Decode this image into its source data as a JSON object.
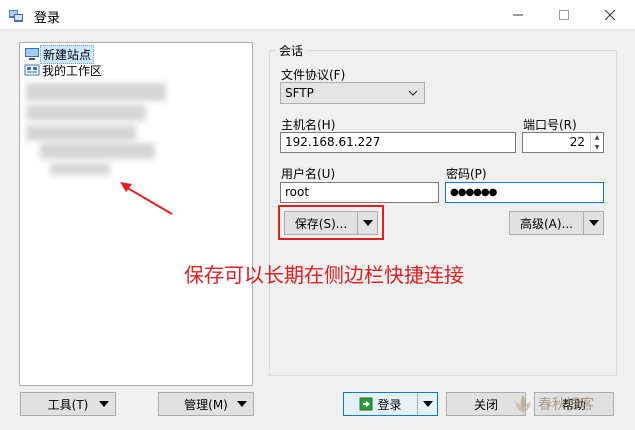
{
  "window": {
    "title": "登录"
  },
  "tree": {
    "items": [
      {
        "label": "新建站点"
      },
      {
        "label": "我的工作区"
      }
    ]
  },
  "left_buttons": {
    "tools": "工具(T)",
    "manage": "管理(M)"
  },
  "session": {
    "legend": "会话",
    "protocol_label": "文件协议(F)",
    "protocol_value": "SFTP",
    "host_label": "主机名(H)",
    "host_value": "192.168.61.227",
    "port_label": "端口号(R)",
    "port_value": "22",
    "user_label": "用户名(U)",
    "user_value": "root",
    "password_label": "密码(P)",
    "password_value": "●●●●●●",
    "save_button": "保存(S)...",
    "advanced_button": "高级(A)..."
  },
  "bottom_buttons": {
    "login": "登录",
    "close": "关闭",
    "help": "帮助"
  },
  "annotation": {
    "text": "保存可以长期在侧边栏快捷连接",
    "color": "#e02020"
  },
  "watermark": {
    "text": "春秋博客"
  }
}
